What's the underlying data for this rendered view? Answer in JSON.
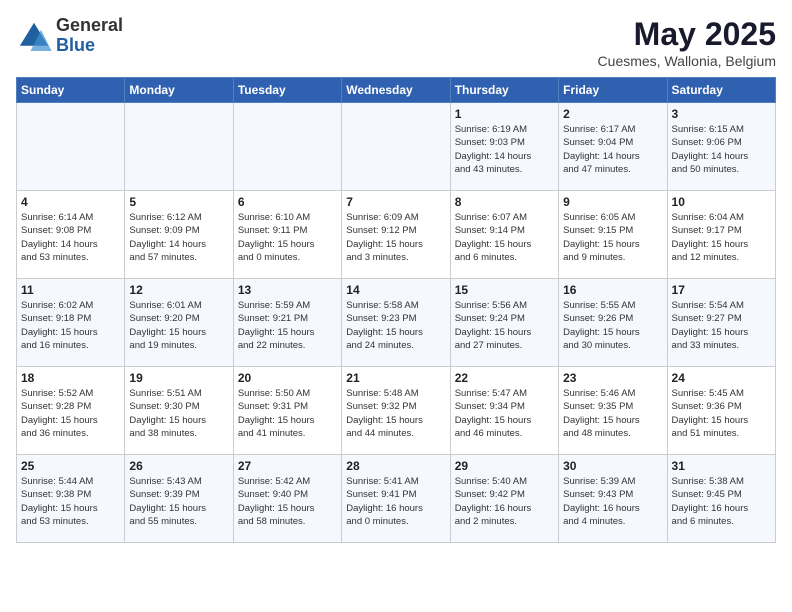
{
  "logo": {
    "general": "General",
    "blue": "Blue"
  },
  "title": "May 2025",
  "subtitle": "Cuesmes, Wallonia, Belgium",
  "headers": [
    "Sunday",
    "Monday",
    "Tuesday",
    "Wednesday",
    "Thursday",
    "Friday",
    "Saturday"
  ],
  "weeks": [
    [
      {
        "day": "",
        "info": ""
      },
      {
        "day": "",
        "info": ""
      },
      {
        "day": "",
        "info": ""
      },
      {
        "day": "",
        "info": ""
      },
      {
        "day": "1",
        "info": "Sunrise: 6:19 AM\nSunset: 9:03 PM\nDaylight: 14 hours\nand 43 minutes."
      },
      {
        "day": "2",
        "info": "Sunrise: 6:17 AM\nSunset: 9:04 PM\nDaylight: 14 hours\nand 47 minutes."
      },
      {
        "day": "3",
        "info": "Sunrise: 6:15 AM\nSunset: 9:06 PM\nDaylight: 14 hours\nand 50 minutes."
      }
    ],
    [
      {
        "day": "4",
        "info": "Sunrise: 6:14 AM\nSunset: 9:08 PM\nDaylight: 14 hours\nand 53 minutes."
      },
      {
        "day": "5",
        "info": "Sunrise: 6:12 AM\nSunset: 9:09 PM\nDaylight: 14 hours\nand 57 minutes."
      },
      {
        "day": "6",
        "info": "Sunrise: 6:10 AM\nSunset: 9:11 PM\nDaylight: 15 hours\nand 0 minutes."
      },
      {
        "day": "7",
        "info": "Sunrise: 6:09 AM\nSunset: 9:12 PM\nDaylight: 15 hours\nand 3 minutes."
      },
      {
        "day": "8",
        "info": "Sunrise: 6:07 AM\nSunset: 9:14 PM\nDaylight: 15 hours\nand 6 minutes."
      },
      {
        "day": "9",
        "info": "Sunrise: 6:05 AM\nSunset: 9:15 PM\nDaylight: 15 hours\nand 9 minutes."
      },
      {
        "day": "10",
        "info": "Sunrise: 6:04 AM\nSunset: 9:17 PM\nDaylight: 15 hours\nand 12 minutes."
      }
    ],
    [
      {
        "day": "11",
        "info": "Sunrise: 6:02 AM\nSunset: 9:18 PM\nDaylight: 15 hours\nand 16 minutes."
      },
      {
        "day": "12",
        "info": "Sunrise: 6:01 AM\nSunset: 9:20 PM\nDaylight: 15 hours\nand 19 minutes."
      },
      {
        "day": "13",
        "info": "Sunrise: 5:59 AM\nSunset: 9:21 PM\nDaylight: 15 hours\nand 22 minutes."
      },
      {
        "day": "14",
        "info": "Sunrise: 5:58 AM\nSunset: 9:23 PM\nDaylight: 15 hours\nand 24 minutes."
      },
      {
        "day": "15",
        "info": "Sunrise: 5:56 AM\nSunset: 9:24 PM\nDaylight: 15 hours\nand 27 minutes."
      },
      {
        "day": "16",
        "info": "Sunrise: 5:55 AM\nSunset: 9:26 PM\nDaylight: 15 hours\nand 30 minutes."
      },
      {
        "day": "17",
        "info": "Sunrise: 5:54 AM\nSunset: 9:27 PM\nDaylight: 15 hours\nand 33 minutes."
      }
    ],
    [
      {
        "day": "18",
        "info": "Sunrise: 5:52 AM\nSunset: 9:28 PM\nDaylight: 15 hours\nand 36 minutes."
      },
      {
        "day": "19",
        "info": "Sunrise: 5:51 AM\nSunset: 9:30 PM\nDaylight: 15 hours\nand 38 minutes."
      },
      {
        "day": "20",
        "info": "Sunrise: 5:50 AM\nSunset: 9:31 PM\nDaylight: 15 hours\nand 41 minutes."
      },
      {
        "day": "21",
        "info": "Sunrise: 5:48 AM\nSunset: 9:32 PM\nDaylight: 15 hours\nand 44 minutes."
      },
      {
        "day": "22",
        "info": "Sunrise: 5:47 AM\nSunset: 9:34 PM\nDaylight: 15 hours\nand 46 minutes."
      },
      {
        "day": "23",
        "info": "Sunrise: 5:46 AM\nSunset: 9:35 PM\nDaylight: 15 hours\nand 48 minutes."
      },
      {
        "day": "24",
        "info": "Sunrise: 5:45 AM\nSunset: 9:36 PM\nDaylight: 15 hours\nand 51 minutes."
      }
    ],
    [
      {
        "day": "25",
        "info": "Sunrise: 5:44 AM\nSunset: 9:38 PM\nDaylight: 15 hours\nand 53 minutes."
      },
      {
        "day": "26",
        "info": "Sunrise: 5:43 AM\nSunset: 9:39 PM\nDaylight: 15 hours\nand 55 minutes."
      },
      {
        "day": "27",
        "info": "Sunrise: 5:42 AM\nSunset: 9:40 PM\nDaylight: 15 hours\nand 58 minutes."
      },
      {
        "day": "28",
        "info": "Sunrise: 5:41 AM\nSunset: 9:41 PM\nDaylight: 16 hours\nand 0 minutes."
      },
      {
        "day": "29",
        "info": "Sunrise: 5:40 AM\nSunset: 9:42 PM\nDaylight: 16 hours\nand 2 minutes."
      },
      {
        "day": "30",
        "info": "Sunrise: 5:39 AM\nSunset: 9:43 PM\nDaylight: 16 hours\nand 4 minutes."
      },
      {
        "day": "31",
        "info": "Sunrise: 5:38 AM\nSunset: 9:45 PM\nDaylight: 16 hours\nand 6 minutes."
      }
    ]
  ]
}
